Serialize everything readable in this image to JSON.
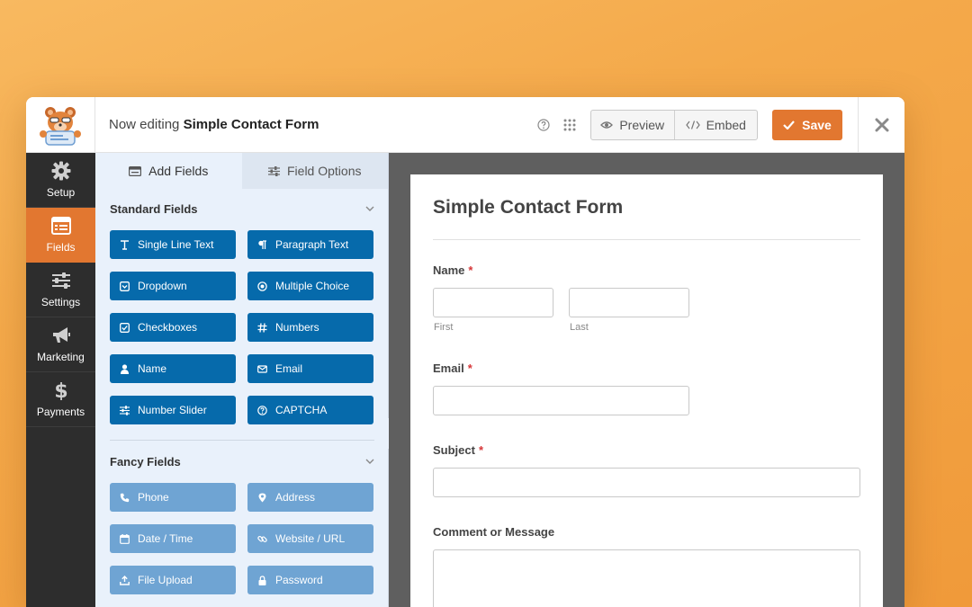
{
  "header": {
    "editing_prefix": "Now editing",
    "form_name": "Simple Contact Form",
    "preview_label": "Preview",
    "embed_label": "Embed",
    "save_label": "Save"
  },
  "leftnav": {
    "items": [
      {
        "label": "Setup",
        "icon": "gear-icon"
      },
      {
        "label": "Fields",
        "icon": "fields-icon"
      },
      {
        "label": "Settings",
        "icon": "sliders-icon"
      },
      {
        "label": "Marketing",
        "icon": "megaphone-icon"
      },
      {
        "label": "Payments",
        "icon": "dollar-icon"
      }
    ],
    "active": "Fields"
  },
  "panel": {
    "tabs": [
      {
        "label": "Add Fields"
      },
      {
        "label": "Field Options"
      }
    ],
    "standard_title": "Standard Fields",
    "standard_fields": [
      {
        "label": "Single Line Text"
      },
      {
        "label": "Paragraph Text"
      },
      {
        "label": "Dropdown"
      },
      {
        "label": "Multiple Choice"
      },
      {
        "label": "Checkboxes"
      },
      {
        "label": "Numbers"
      },
      {
        "label": "Name"
      },
      {
        "label": "Email"
      },
      {
        "label": "Number Slider"
      },
      {
        "label": "CAPTCHA"
      }
    ],
    "fancy_title": "Fancy Fields",
    "fancy_fields": [
      {
        "label": "Phone"
      },
      {
        "label": "Address"
      },
      {
        "label": "Date / Time"
      },
      {
        "label": "Website / URL"
      },
      {
        "label": "File Upload"
      },
      {
        "label": "Password"
      }
    ]
  },
  "form": {
    "title": "Simple Contact Form",
    "name_label": "Name",
    "first_label": "First",
    "last_label": "Last",
    "email_label": "Email",
    "subject_label": "Subject",
    "message_label": "Comment or Message",
    "required_mark": "*"
  },
  "colors": {
    "accent_orange": "#e27730",
    "standard_button": "#066aab",
    "fancy_button": "#6fa4d3",
    "nav_bg": "#2d2d2d",
    "required": "#d63638"
  }
}
